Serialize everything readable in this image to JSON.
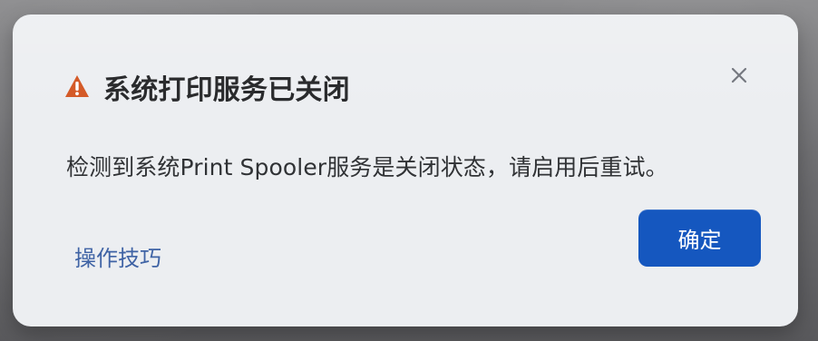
{
  "dialog": {
    "title": "系统打印服务已关闭",
    "message": "检测到系统Print Spooler服务是关闭状态，请启用后重试。",
    "tips_label": "操作技巧",
    "confirm_label": "确定",
    "warning_icon": "warning-icon",
    "close_icon": "close-icon"
  },
  "colors": {
    "warning": "#d45a28",
    "title": "#2a2b2d",
    "message": "#303235",
    "link": "#3f63a5",
    "primary_button": "#1557bf",
    "dialog_background": "#eceef1"
  }
}
